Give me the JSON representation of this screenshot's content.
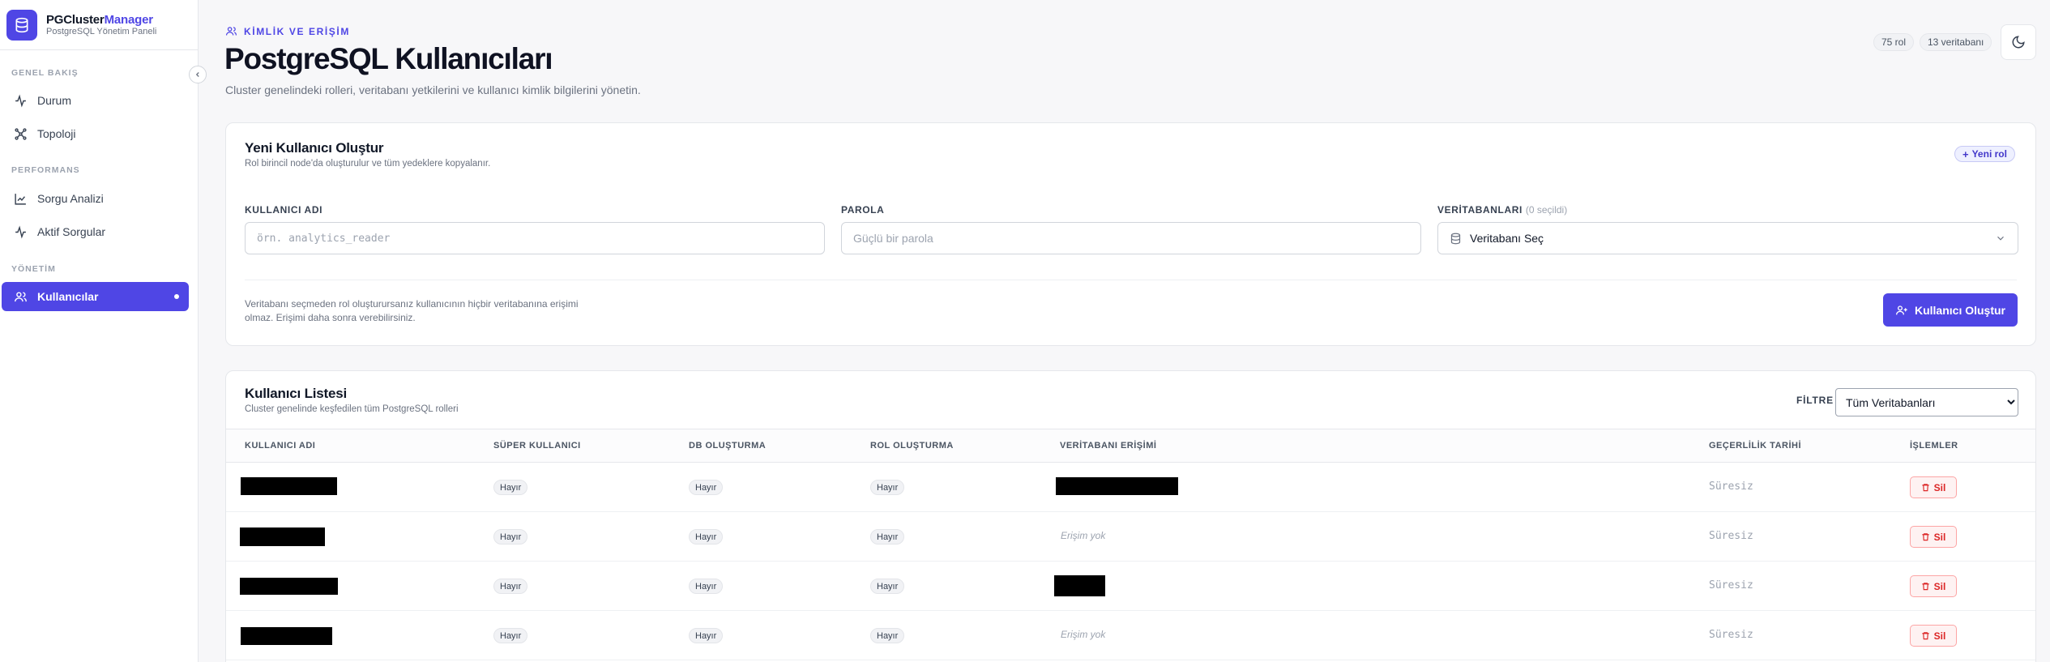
{
  "brand": {
    "name_primary": "PGCluster",
    "name_accent": "Manager",
    "subtitle": "PostgreSQL Yönetim Paneli"
  },
  "sidebar": {
    "sections": [
      {
        "label": "GENEL BAKIŞ"
      },
      {
        "label": "PERFORMANS"
      },
      {
        "label": "YÖNETİM"
      }
    ],
    "items": [
      {
        "label": "Durum",
        "icon": "activity-icon"
      },
      {
        "label": "Topoloji",
        "icon": "topology-icon"
      },
      {
        "label": "Sorgu Analizi",
        "icon": "chart-line-icon"
      },
      {
        "label": "Aktif Sorgular",
        "icon": "activity-icon"
      },
      {
        "label": "Kullanıcılar",
        "icon": "users-icon",
        "active": true
      }
    ]
  },
  "header": {
    "eyebrow": "KİMLİK VE ERİŞİM",
    "title": "PostgreSQL Kullanıcıları",
    "description": "Cluster genelindeki rolleri, veritabanı yetkilerini ve kullanıcı kimlik bilgilerini yönetin.",
    "role_count": "75 rol",
    "db_count": "13 veritabanı"
  },
  "create_form": {
    "title": "Yeni Kullanıcı Oluştur",
    "subtitle": "Rol birincil node'da oluşturulur ve tüm yedeklere kopyalanır.",
    "new_role_button": "Yeni rol",
    "username_label": "KULLANICI ADI",
    "username_placeholder": "örn. analytics_reader",
    "username_value": "",
    "password_label": "PAROLA",
    "password_placeholder": "Güçlü bir parola",
    "password_value": "",
    "databases_label": "VERİTABANLARI",
    "databases_count": "(0 seçildi)",
    "databases_select": "Veritabanı Seç",
    "hint": "Veritabanı seçmeden rol oluşturursanız kullanıcının hiçbir veritabanına erişimi olmaz. Erişimi daha sonra verebilirsiniz.",
    "submit_button": "Kullanıcı Oluştur"
  },
  "user_list": {
    "title": "Kullanıcı Listesi",
    "subtitle": "Cluster genelinde keşfedilen tüm PostgreSQL rolleri",
    "filter_label": "FİLTRE",
    "filter_value": "Tüm Veritabanları",
    "columns": {
      "username": "KULLANICI ADI",
      "superuser": "SÜPER KULLANICI",
      "create_db": "DB OLUŞTURMA",
      "create_role": "ROL OLUŞTURMA",
      "db_access": "VERİTABANI ERİŞİMİ",
      "validity": "GEÇERLİLİK TARİHİ",
      "actions": "İŞLEMLER"
    },
    "rows": [
      {
        "superuser": "Hayır",
        "create_db": "Hayır",
        "create_role": "Hayır",
        "access": "",
        "validity": "Süresiz",
        "delete": "Sil"
      },
      {
        "superuser": "Hayır",
        "create_db": "Hayır",
        "create_role": "Hayır",
        "access": "Erişim yok",
        "validity": "Süresiz",
        "delete": "Sil"
      },
      {
        "superuser": "Hayır",
        "create_db": "Hayır",
        "create_role": "Hayır",
        "access": "",
        "validity": "Süresiz",
        "delete": "Sil"
      },
      {
        "superuser": "Hayır",
        "create_db": "Hayır",
        "create_role": "Hayır",
        "access": "Erişim yok",
        "validity": "Süresiz",
        "delete": "Sil"
      }
    ]
  },
  "colors": {
    "accent": "#4f46e5",
    "danger": "#dc2626",
    "sidebar_bg": "#ffffff",
    "page_bg": "#f7f7f9"
  }
}
